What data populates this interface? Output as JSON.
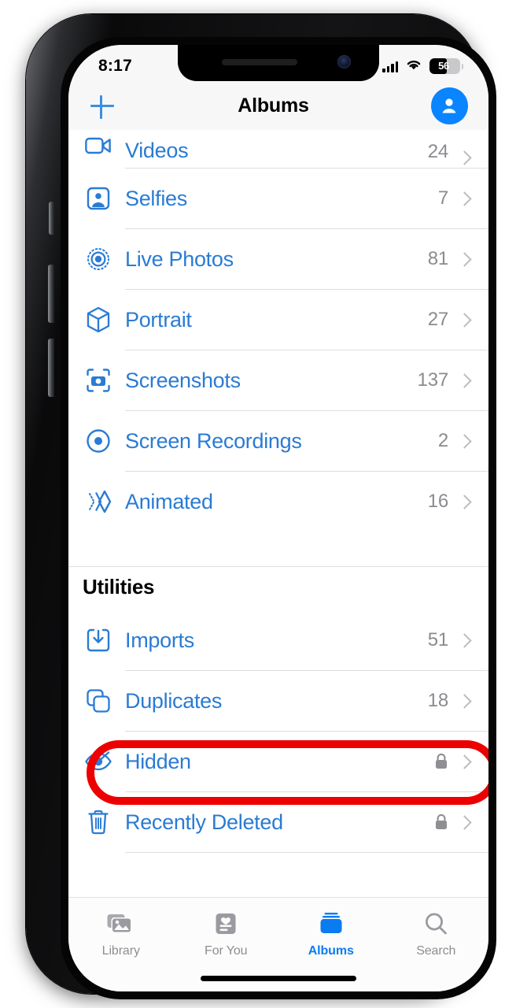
{
  "status_bar": {
    "time": "8:17",
    "cellular_icon": "cellular-bars-icon",
    "wifi_icon": "wifi-icon",
    "battery_percent": "56",
    "battery_level": 56
  },
  "nav_bar": {
    "add_icon": "plus-icon",
    "title": "Albums",
    "account_icon": "person-circle-icon"
  },
  "media_types_rows": [
    {
      "icon": "video-camera-icon",
      "label": "Videos",
      "count": "24",
      "clipped": true
    },
    {
      "icon": "person-portrait-icon",
      "label": "Selfies",
      "count": "7"
    },
    {
      "icon": "live-photo-icon",
      "label": "Live Photos",
      "count": "81"
    },
    {
      "icon": "cube-icon",
      "label": "Portrait",
      "count": "27"
    },
    {
      "icon": "screenshot-camera-icon",
      "label": "Screenshots",
      "count": "137"
    },
    {
      "icon": "record-circle-icon",
      "label": "Screen Recordings",
      "count": "2"
    },
    {
      "icon": "animated-chevrons-icon",
      "label": "Animated",
      "count": "16"
    }
  ],
  "utilities": {
    "header": "Utilities",
    "rows": [
      {
        "icon": "import-tray-icon",
        "label": "Imports",
        "count": "51",
        "locked": false,
        "highlighted": false
      },
      {
        "icon": "duplicate-squares-icon",
        "label": "Duplicates",
        "count": "18",
        "locked": false,
        "highlighted": false
      },
      {
        "icon": "eye-slash-icon",
        "label": "Hidden",
        "count": "",
        "locked": true,
        "highlighted": true
      },
      {
        "icon": "trash-icon",
        "label": "Recently Deleted",
        "count": "",
        "locked": true,
        "highlighted": false
      }
    ]
  },
  "tab_bar": {
    "tabs": [
      {
        "icon": "photo-stack-icon",
        "label": "Library",
        "active": false
      },
      {
        "icon": "heart-card-icon",
        "label": "For You",
        "active": false
      },
      {
        "icon": "albums-icon",
        "label": "Albums",
        "active": true
      },
      {
        "icon": "magnifier-icon",
        "label": "Search",
        "active": false
      }
    ]
  },
  "colors": {
    "link_blue": "#2a7bd4",
    "accent_blue": "#0a84ff",
    "annotation_red": "#ec0000",
    "count_gray": "#8b8b90"
  }
}
